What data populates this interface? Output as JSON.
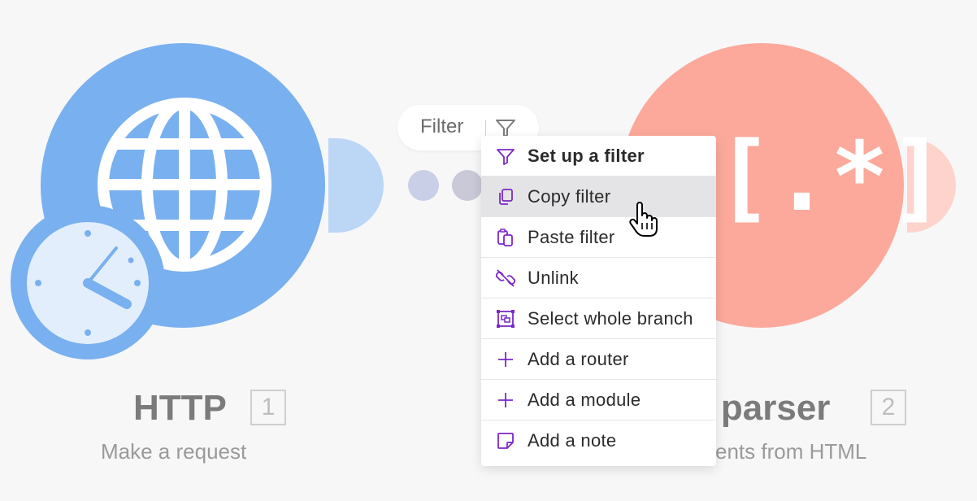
{
  "modules": {
    "http": {
      "title": "HTTP",
      "number": "1",
      "subtitle": "Make a request",
      "color": "#79b0ef"
    },
    "text_parser": {
      "title_visible": "t parser",
      "number": "2",
      "subtitle_visible": "ents from HTML",
      "glyph": "[.*]",
      "color": "#fca99b"
    }
  },
  "connection": {
    "filter_label": "Filter",
    "filter_icon": "funnel-icon"
  },
  "context_menu": {
    "items": [
      {
        "label": "Set up a filter",
        "icon": "funnel-icon",
        "bold": true
      },
      {
        "label": "Copy filter",
        "icon": "copy-icon",
        "highlighted": true
      },
      {
        "label": "Paste filter",
        "icon": "paste-icon"
      },
      {
        "label": "Unlink",
        "icon": "unlink-icon"
      },
      {
        "label": "Select whole branch",
        "icon": "select-branch-icon"
      },
      {
        "label": "Add a router",
        "icon": "plus-icon"
      },
      {
        "label": "Add a module",
        "icon": "plus-icon"
      },
      {
        "label": "Add a note",
        "icon": "note-icon"
      }
    ],
    "icon_color": "#7a28c8"
  }
}
